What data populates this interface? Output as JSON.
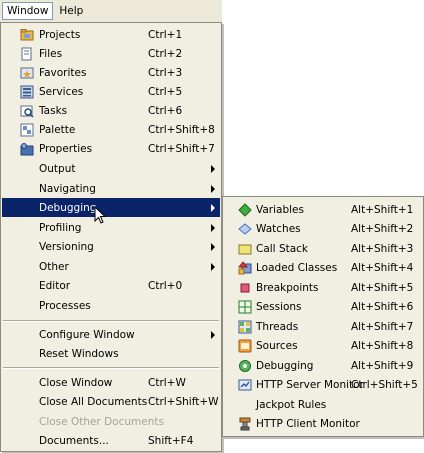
{
  "menubar": {
    "window": "Window",
    "help": "Help"
  },
  "window_menu": {
    "items": [
      {
        "label": "Projects",
        "shortcut": "Ctrl+1",
        "icon": "projects-icon"
      },
      {
        "label": "Files",
        "shortcut": "Ctrl+2",
        "icon": "files-icon"
      },
      {
        "label": "Favorites",
        "shortcut": "Ctrl+3",
        "icon": "favorites-icon"
      },
      {
        "label": "Services",
        "shortcut": "Ctrl+5",
        "icon": "services-icon"
      },
      {
        "label": "Tasks",
        "shortcut": "Ctrl+6",
        "icon": "tasks-icon"
      },
      {
        "label": "Palette",
        "shortcut": "Ctrl+Shift+8",
        "icon": "palette-icon"
      },
      {
        "label": "Properties",
        "shortcut": "Ctrl+Shift+7",
        "icon": "properties-icon"
      },
      {
        "label": "Output"
      },
      {
        "label": "Navigating"
      },
      {
        "label": "Debugging"
      },
      {
        "label": "Profiling"
      },
      {
        "label": "Versioning"
      },
      {
        "label": "Other"
      },
      {
        "label": "Editor",
        "shortcut": "Ctrl+0"
      },
      {
        "label": "Processes"
      },
      {
        "label": "Configure Window"
      },
      {
        "label": "Reset Windows"
      },
      {
        "label": "Close Window",
        "shortcut": "Ctrl+W"
      },
      {
        "label": "Close All Documents",
        "shortcut": "Ctrl+Shift+W"
      },
      {
        "label": "Close Other Documents"
      },
      {
        "label": "Documents...",
        "shortcut": "Shift+F4"
      }
    ]
  },
  "debug_menu": {
    "items": [
      {
        "label": "Variables",
        "shortcut": "Alt+Shift+1",
        "icon": "variables-icon"
      },
      {
        "label": "Watches",
        "shortcut": "Alt+Shift+2",
        "icon": "watches-icon"
      },
      {
        "label": "Call Stack",
        "shortcut": "Alt+Shift+3",
        "icon": "call-stack-icon"
      },
      {
        "label": "Loaded Classes",
        "shortcut": "Alt+Shift+4",
        "icon": "loaded-classes-icon"
      },
      {
        "label": "Breakpoints",
        "shortcut": "Alt+Shift+5",
        "icon": "breakpoints-icon"
      },
      {
        "label": "Sessions",
        "shortcut": "Alt+Shift+6",
        "icon": "sessions-icon"
      },
      {
        "label": "Threads",
        "shortcut": "Alt+Shift+7",
        "icon": "threads-icon"
      },
      {
        "label": "Sources",
        "shortcut": "Alt+Shift+8",
        "icon": "sources-icon"
      },
      {
        "label": "Debugging",
        "shortcut": "Alt+Shift+9",
        "icon": "debugging-icon"
      },
      {
        "label": "HTTP Server Monitor",
        "shortcut": "Ctrl+Shift+5",
        "icon": "http-server-monitor-icon"
      },
      {
        "label": "Jackpot Rules"
      },
      {
        "label": "HTTP Client Monitor",
        "icon": "http-client-monitor-icon"
      }
    ]
  },
  "colors": {
    "menu_bg": "#f1efe2",
    "highlight": "#0a246a",
    "disabled": "#a6a392"
  }
}
